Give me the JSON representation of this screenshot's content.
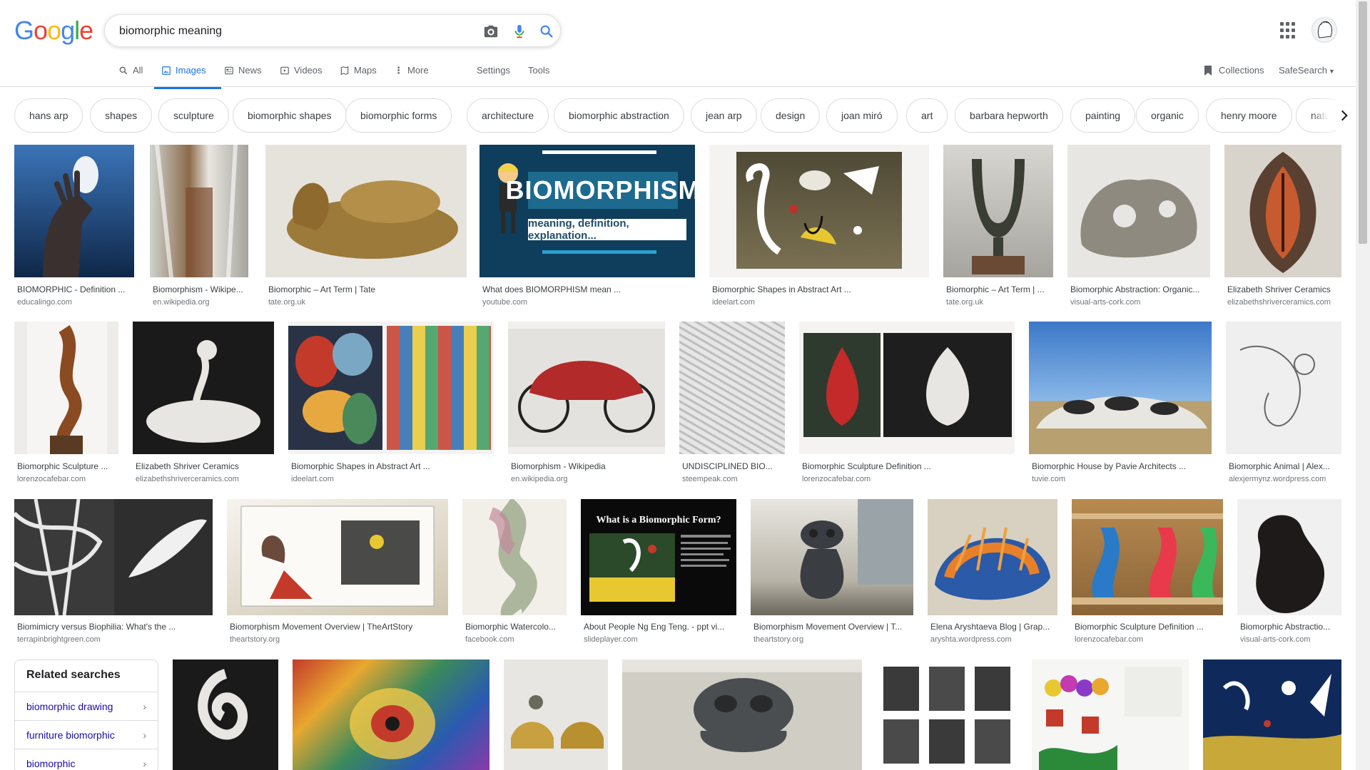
{
  "logo": "Google",
  "search": {
    "query": "biomorphic meaning",
    "camera_icon": "camera-icon",
    "mic_icon": "mic-icon",
    "search_icon": "search-icon"
  },
  "nav": {
    "tabs": [
      {
        "label": "All",
        "icon": "search-icon",
        "active": false
      },
      {
        "label": "Images",
        "icon": "image-icon",
        "active": true
      },
      {
        "label": "News",
        "icon": "news-icon",
        "active": false
      },
      {
        "label": "Videos",
        "icon": "video-icon",
        "active": false
      },
      {
        "label": "Maps",
        "icon": "map-icon",
        "active": false
      },
      {
        "label": "More",
        "icon": "more-vert-icon",
        "active": false
      }
    ],
    "settings": "Settings",
    "tools": "Tools",
    "collections": "Collections",
    "safesearch": "SafeSearch"
  },
  "chips": [
    "hans arp",
    "shapes",
    "sculpture",
    "biomorphic shapes",
    "biomorphic forms",
    "architecture",
    "biomorphic abstraction",
    "jean arp",
    "design",
    "joan miró",
    "art",
    "barbara hepworth",
    "painting",
    "organic",
    "henry moore",
    "natu"
  ],
  "results": [
    {
      "caption": "BIOMORPHIC - Definition ...",
      "source": "educalingo.com"
    },
    {
      "caption": "Biomorphism - Wikipe...",
      "source": "en.wikipedia.org"
    },
    {
      "caption": "Biomorphic – Art Term | Tate",
      "source": "tate.org.uk"
    },
    {
      "caption": "What does BIOMORPHISM mean ...",
      "source": "youtube.com"
    },
    {
      "caption": "Biomorphic Shapes in Abstract Art ...",
      "source": "ideelart.com"
    },
    {
      "caption": "Biomorphic – Art Term | ...",
      "source": "tate.org.uk"
    },
    {
      "caption": "Biomorphic Abstraction: Organic...",
      "source": "visual-arts-cork.com"
    },
    {
      "caption": "Elizabeth Shriver Ceramics",
      "source": "elizabethshriverceramics.com"
    },
    {
      "caption": "Biomorphic Sculpture ...",
      "source": "lorenzocafebar.com"
    },
    {
      "caption": "Elizabeth Shriver Ceramics",
      "source": "elizabethshriverceramics.com"
    },
    {
      "caption": "Biomorphic Shapes in Abstract Art ...",
      "source": "ideelart.com"
    },
    {
      "caption": "Biomorphism - Wikipedia",
      "source": "en.wikipedia.org"
    },
    {
      "caption": "UNDISCIPLINED BIO...",
      "source": "steempeak.com"
    },
    {
      "caption": "Biomorphic Sculpture Definition ...",
      "source": "lorenzocafebar.com"
    },
    {
      "caption": "Biomorphic House by Pavie Architects ...",
      "source": "tuvie.com"
    },
    {
      "caption": "Biomorphic Animal | Alex...",
      "source": "alexjermynz.wordpress.com"
    },
    {
      "caption": "Biomimicry versus Biophilia: What's the ...",
      "source": "terrapinbrightgreen.com"
    },
    {
      "caption": "Biomorphism Movement Overview | TheArtStory",
      "source": "theartstory.org"
    },
    {
      "caption": "Biomorphic Watercolo...",
      "source": "facebook.com"
    },
    {
      "caption": "About People Ng Eng Teng. - ppt vi...",
      "source": "slideplayer.com"
    },
    {
      "caption": "Biomorphism Movement Overview | T...",
      "source": "theartstory.org"
    },
    {
      "caption": "Elena Aryshtaeva Blog | Grap...",
      "source": "aryshta.wordpress.com"
    },
    {
      "caption": "Biomorphic Sculpture Definition ...",
      "source": "lorenzocafebar.com"
    },
    {
      "caption": "Biomorphic Abstractio...",
      "source": "visual-arts-cork.com"
    }
  ],
  "thumb_text": {
    "youtube_title": "BIOMORPHISM",
    "youtube_sub": "meaning, definition, explanation...",
    "slide_title": "What is a Biomorphic Form?"
  },
  "related": {
    "title": "Related searches",
    "items": [
      "biomorphic drawing",
      "furniture biomorphic",
      "biomorphic"
    ]
  },
  "colors": {
    "accent": "#1a73e8",
    "link": "#1a0dab",
    "border": "#dadce0"
  }
}
